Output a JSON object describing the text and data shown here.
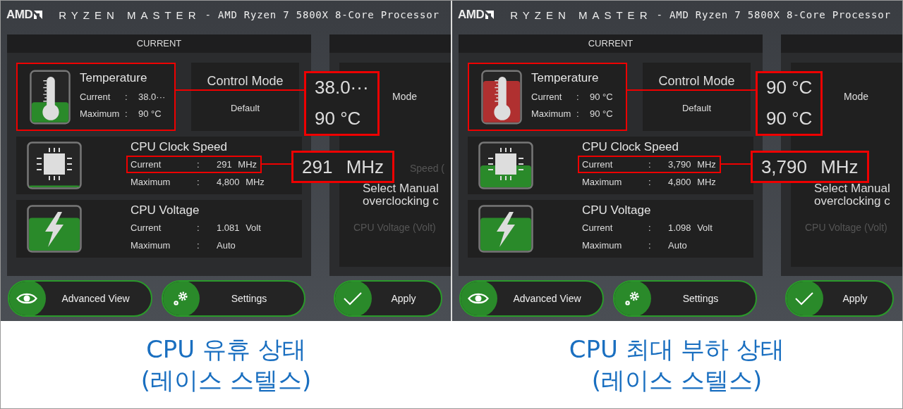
{
  "panels": [
    {
      "logo": "AMD",
      "app_title": "RYZEN MASTER",
      "processor": "- AMD Ryzen 7 5800X 8-Core Processor",
      "section_header": "CURRENT",
      "temperature": {
        "title": "Temperature",
        "hot": false,
        "highlighted": true,
        "rows": [
          {
            "label": "Current",
            "separator": ":",
            "value": "38.0···"
          },
          {
            "label": "Maximum",
            "separator": ":",
            "value": "90 °C"
          }
        ],
        "callout": [
          "38.0···",
          "90 °C"
        ]
      },
      "control_mode": {
        "title": "Control Mode",
        "value": "Default"
      },
      "metrics": [
        {
          "kind": "clock",
          "title": "CPU Clock Speed",
          "loaded": false,
          "rows": [
            {
              "label": "Current",
              "separator": ":",
              "value": "291 MHz",
              "highlighted": true,
              "callout": "291 MHz"
            },
            {
              "label": "Maximum",
              "separator": ":",
              "value": "4,800 MHz",
              "highlighted": false
            }
          ]
        },
        {
          "kind": "voltage",
          "title": "CPU Voltage",
          "rows": [
            {
              "label": "Current",
              "separator": ":",
              "value": "1.081 Volt",
              "highlighted": false
            },
            {
              "label": "Maximum",
              "separator": ":",
              "value": "Auto",
              "highlighted": false
            }
          ]
        }
      ],
      "right": {
        "mode_label": "Mode",
        "faint_label": "Speed (",
        "description": [
          "Select Manual",
          "overclocking c"
        ],
        "voltage_label": "CPU Voltage (Volt)"
      },
      "buttons": [
        {
          "kind": "eye",
          "label": "Advanced View"
        },
        {
          "kind": "gears",
          "label": "Settings"
        },
        {
          "kind": "check",
          "label": "Apply"
        }
      ],
      "caption": [
        "CPU 유휴 상태",
        "(레이스 스텔스)"
      ]
    },
    {
      "logo": "AMD",
      "app_title": "RYZEN MASTER",
      "processor": "- AMD Ryzen 7 5800X 8-Core Processor",
      "section_header": "CURRENT",
      "temperature": {
        "title": "Temperature",
        "hot": true,
        "highlighted": true,
        "rows": [
          {
            "label": "Current",
            "separator": ":",
            "value": "90 °C"
          },
          {
            "label": "Maximum",
            "separator": ":",
            "value": "90 °C"
          }
        ],
        "callout": [
          "90 °C",
          "90 °C"
        ]
      },
      "control_mode": {
        "title": "Control Mode",
        "value": "Default"
      },
      "metrics": [
        {
          "kind": "clock",
          "title": "CPU Clock Speed",
          "loaded": true,
          "rows": [
            {
              "label": "Current",
              "separator": ":",
              "value": "3,790 MHz",
              "highlighted": true,
              "callout": "3,790 MHz"
            },
            {
              "label": "Maximum",
              "separator": ":",
              "value": "4,800 MHz",
              "highlighted": false
            }
          ]
        },
        {
          "kind": "voltage",
          "title": "CPU Voltage",
          "rows": [
            {
              "label": "Current",
              "separator": ":",
              "value": "1.098 Volt",
              "highlighted": false
            },
            {
              "label": "Maximum",
              "separator": ":",
              "value": "Auto",
              "highlighted": false
            }
          ]
        }
      ],
      "right": {
        "mode_label": "Mode",
        "description": [
          "Select Manual",
          "overclocking c"
        ],
        "voltage_label": "CPU Voltage (Volt)"
      },
      "buttons": [
        {
          "kind": "eye",
          "label": "Advanced View"
        },
        {
          "kind": "gears",
          "label": "Settings"
        },
        {
          "kind": "check",
          "label": "Apply"
        }
      ],
      "caption": [
        "CPU 최대 부하 상태",
        "(레이스 스텔스)"
      ]
    }
  ]
}
